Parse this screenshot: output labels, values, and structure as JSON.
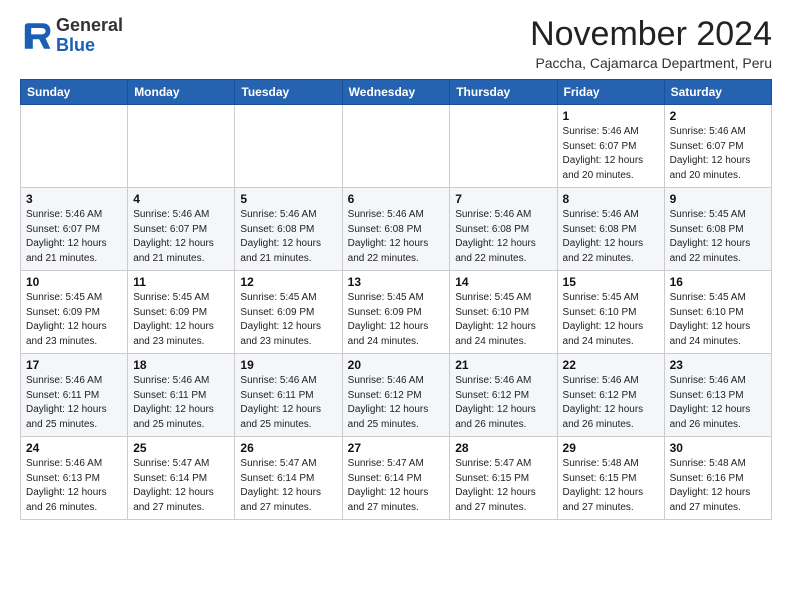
{
  "logo": {
    "line1": "General",
    "line2": "Blue"
  },
  "title": "November 2024",
  "location": "Paccha, Cajamarca Department, Peru",
  "weekdays": [
    "Sunday",
    "Monday",
    "Tuesday",
    "Wednesday",
    "Thursday",
    "Friday",
    "Saturday"
  ],
  "weeks": [
    [
      {
        "day": "",
        "info": ""
      },
      {
        "day": "",
        "info": ""
      },
      {
        "day": "",
        "info": ""
      },
      {
        "day": "",
        "info": ""
      },
      {
        "day": "",
        "info": ""
      },
      {
        "day": "1",
        "info": "Sunrise: 5:46 AM\nSunset: 6:07 PM\nDaylight: 12 hours\nand 20 minutes."
      },
      {
        "day": "2",
        "info": "Sunrise: 5:46 AM\nSunset: 6:07 PM\nDaylight: 12 hours\nand 20 minutes."
      }
    ],
    [
      {
        "day": "3",
        "info": "Sunrise: 5:46 AM\nSunset: 6:07 PM\nDaylight: 12 hours\nand 21 minutes."
      },
      {
        "day": "4",
        "info": "Sunrise: 5:46 AM\nSunset: 6:07 PM\nDaylight: 12 hours\nand 21 minutes."
      },
      {
        "day": "5",
        "info": "Sunrise: 5:46 AM\nSunset: 6:08 PM\nDaylight: 12 hours\nand 21 minutes."
      },
      {
        "day": "6",
        "info": "Sunrise: 5:46 AM\nSunset: 6:08 PM\nDaylight: 12 hours\nand 22 minutes."
      },
      {
        "day": "7",
        "info": "Sunrise: 5:46 AM\nSunset: 6:08 PM\nDaylight: 12 hours\nand 22 minutes."
      },
      {
        "day": "8",
        "info": "Sunrise: 5:46 AM\nSunset: 6:08 PM\nDaylight: 12 hours\nand 22 minutes."
      },
      {
        "day": "9",
        "info": "Sunrise: 5:45 AM\nSunset: 6:08 PM\nDaylight: 12 hours\nand 22 minutes."
      }
    ],
    [
      {
        "day": "10",
        "info": "Sunrise: 5:45 AM\nSunset: 6:09 PM\nDaylight: 12 hours\nand 23 minutes."
      },
      {
        "day": "11",
        "info": "Sunrise: 5:45 AM\nSunset: 6:09 PM\nDaylight: 12 hours\nand 23 minutes."
      },
      {
        "day": "12",
        "info": "Sunrise: 5:45 AM\nSunset: 6:09 PM\nDaylight: 12 hours\nand 23 minutes."
      },
      {
        "day": "13",
        "info": "Sunrise: 5:45 AM\nSunset: 6:09 PM\nDaylight: 12 hours\nand 24 minutes."
      },
      {
        "day": "14",
        "info": "Sunrise: 5:45 AM\nSunset: 6:10 PM\nDaylight: 12 hours\nand 24 minutes."
      },
      {
        "day": "15",
        "info": "Sunrise: 5:45 AM\nSunset: 6:10 PM\nDaylight: 12 hours\nand 24 minutes."
      },
      {
        "day": "16",
        "info": "Sunrise: 5:45 AM\nSunset: 6:10 PM\nDaylight: 12 hours\nand 24 minutes."
      }
    ],
    [
      {
        "day": "17",
        "info": "Sunrise: 5:46 AM\nSunset: 6:11 PM\nDaylight: 12 hours\nand 25 minutes."
      },
      {
        "day": "18",
        "info": "Sunrise: 5:46 AM\nSunset: 6:11 PM\nDaylight: 12 hours\nand 25 minutes."
      },
      {
        "day": "19",
        "info": "Sunrise: 5:46 AM\nSunset: 6:11 PM\nDaylight: 12 hours\nand 25 minutes."
      },
      {
        "day": "20",
        "info": "Sunrise: 5:46 AM\nSunset: 6:12 PM\nDaylight: 12 hours\nand 25 minutes."
      },
      {
        "day": "21",
        "info": "Sunrise: 5:46 AM\nSunset: 6:12 PM\nDaylight: 12 hours\nand 26 minutes."
      },
      {
        "day": "22",
        "info": "Sunrise: 5:46 AM\nSunset: 6:12 PM\nDaylight: 12 hours\nand 26 minutes."
      },
      {
        "day": "23",
        "info": "Sunrise: 5:46 AM\nSunset: 6:13 PM\nDaylight: 12 hours\nand 26 minutes."
      }
    ],
    [
      {
        "day": "24",
        "info": "Sunrise: 5:46 AM\nSunset: 6:13 PM\nDaylight: 12 hours\nand 26 minutes."
      },
      {
        "day": "25",
        "info": "Sunrise: 5:47 AM\nSunset: 6:14 PM\nDaylight: 12 hours\nand 27 minutes."
      },
      {
        "day": "26",
        "info": "Sunrise: 5:47 AM\nSunset: 6:14 PM\nDaylight: 12 hours\nand 27 minutes."
      },
      {
        "day": "27",
        "info": "Sunrise: 5:47 AM\nSunset: 6:14 PM\nDaylight: 12 hours\nand 27 minutes."
      },
      {
        "day": "28",
        "info": "Sunrise: 5:47 AM\nSunset: 6:15 PM\nDaylight: 12 hours\nand 27 minutes."
      },
      {
        "day": "29",
        "info": "Sunrise: 5:48 AM\nSunset: 6:15 PM\nDaylight: 12 hours\nand 27 minutes."
      },
      {
        "day": "30",
        "info": "Sunrise: 5:48 AM\nSunset: 6:16 PM\nDaylight: 12 hours\nand 27 minutes."
      }
    ]
  ]
}
